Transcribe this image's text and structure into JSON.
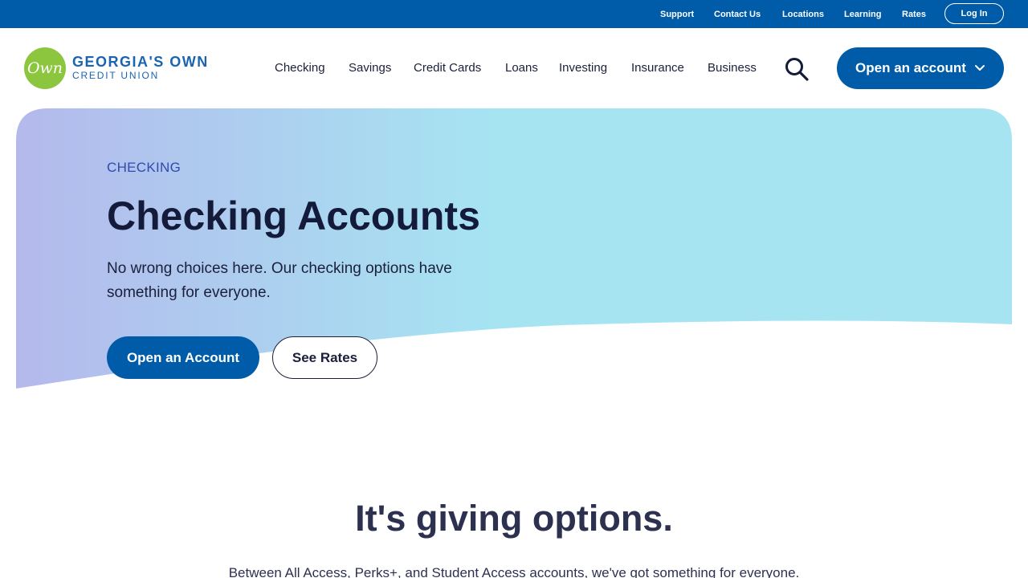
{
  "utility_nav": {
    "links": [
      "Support",
      "Contact Us",
      "Locations",
      "Learning",
      "Rates"
    ],
    "login_label": "Log In"
  },
  "brand": {
    "logo_mark": "Own",
    "name": "GEORGIA'S OWN",
    "subname": "CREDIT UNION"
  },
  "main_nav": {
    "items": [
      "Checking",
      "Savings",
      "Credit Cards",
      "Loans",
      "Investing",
      "Insurance",
      "Business"
    ],
    "search_icon": "search-icon",
    "open_account_label": "Open an account"
  },
  "hero": {
    "eyebrow": "CHECKING",
    "title": "Checking Accounts",
    "description": "No wrong choices here. Our checking options have something for everyone.",
    "primary_cta": "Open an Account",
    "secondary_cta": "See Rates"
  },
  "section": {
    "title": "It's giving options.",
    "description": "Between All Access, Perks+, and Student Access accounts, we've got something for everyone."
  },
  "colors": {
    "brand_blue": "#005ca8",
    "logo_green": "#8cc63f",
    "hero_gradient_start": "#b4b9ec",
    "hero_gradient_end": "#a6e4f2"
  }
}
